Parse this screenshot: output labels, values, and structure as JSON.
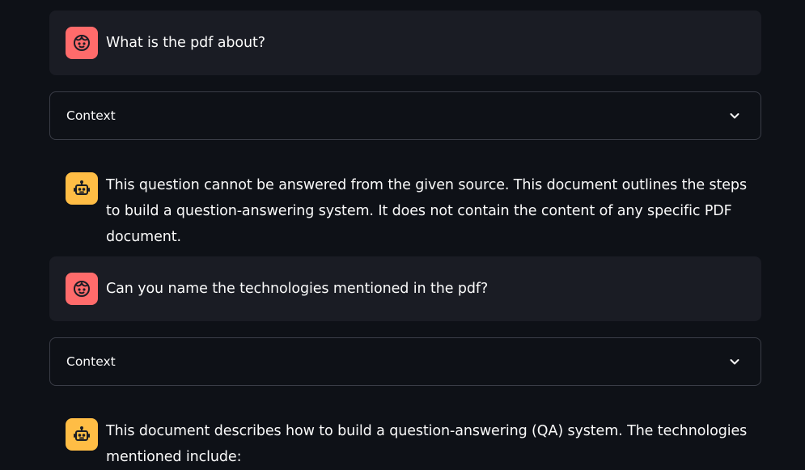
{
  "chat": {
    "messages": [
      {
        "role": "user",
        "avatar_icon": "user-face-icon",
        "text": "What is the pdf about?"
      },
      {
        "role": "assistant",
        "avatar_icon": "robot-icon",
        "text": "This question cannot be answered from the given source. This document outlines the steps to build a question-answering system. It does not contain the content of any specific PDF document."
      },
      {
        "role": "user",
        "avatar_icon": "user-face-icon",
        "text": "Can you name the technologies mentioned in the pdf?"
      },
      {
        "role": "assistant",
        "avatar_icon": "robot-icon",
        "text": "This document describes how to build a question-answering (QA) system. The technologies mentioned include:"
      }
    ],
    "expanders": [
      {
        "label": "Context",
        "icon": "chevron-down-icon"
      },
      {
        "label": "Context",
        "icon": "chevron-down-icon"
      }
    ]
  },
  "colors": {
    "background": "#0e1117",
    "user_bubble": "#1a1c24",
    "user_avatar": "#ff6b6b",
    "assistant_avatar": "#ffbd45",
    "border": "#3a3d47",
    "text": "#fafafa"
  }
}
